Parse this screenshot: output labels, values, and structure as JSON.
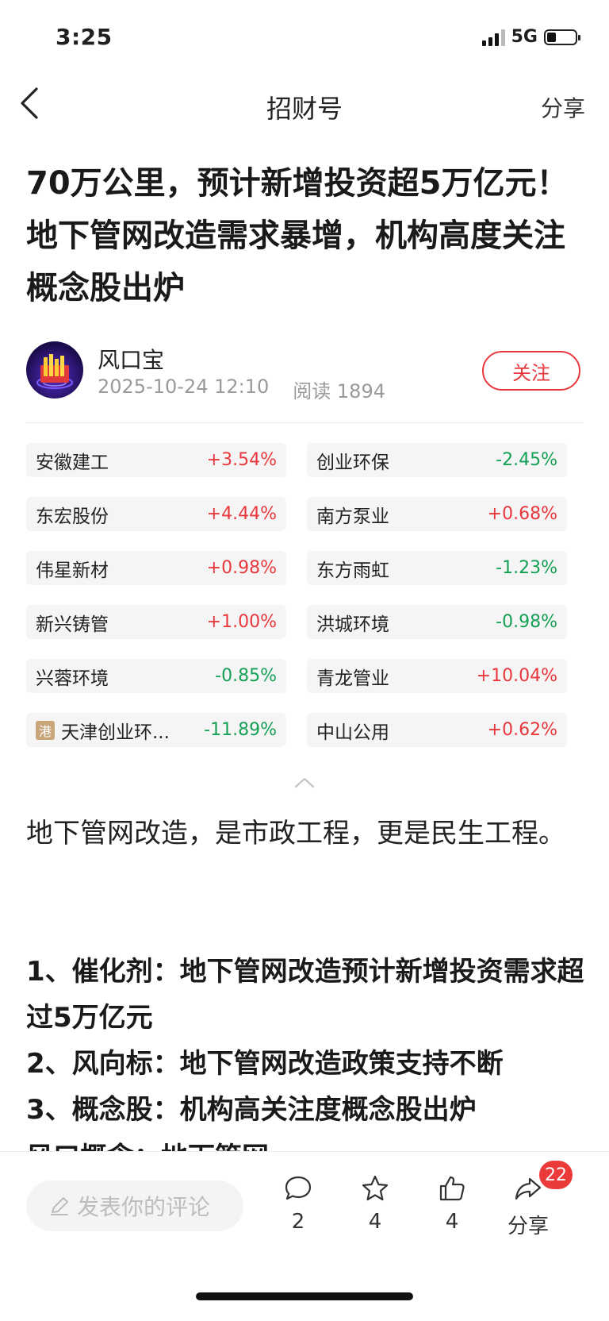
{
  "status_bar": {
    "time": "3:25",
    "network": "5G"
  },
  "nav": {
    "title": "招财号",
    "share_label": "分享"
  },
  "article": {
    "title": "70万公里，预计新增投资超5万亿元！地下管网改造需求暴增，机构高度关注概念股出炉",
    "author": "风口宝",
    "date": "2025-10-24 12:10",
    "read_label": "阅读 1894",
    "follow_label": "关注"
  },
  "stocks": [
    {
      "name": "安徽建工",
      "change": "+3.54%",
      "dir": "up"
    },
    {
      "name": "创业环保",
      "change": "-2.45%",
      "dir": "down"
    },
    {
      "name": "东宏股份",
      "change": "+4.44%",
      "dir": "up"
    },
    {
      "name": "南方泵业",
      "change": "+0.68%",
      "dir": "up"
    },
    {
      "name": "伟星新材",
      "change": "+0.98%",
      "dir": "up"
    },
    {
      "name": "东方雨虹",
      "change": "-1.23%",
      "dir": "down"
    },
    {
      "name": "新兴铸管",
      "change": "+1.00%",
      "dir": "up"
    },
    {
      "name": "洪城环境",
      "change": "-0.98%",
      "dir": "down"
    },
    {
      "name": "兴蓉环境",
      "change": "-0.85%",
      "dir": "down"
    },
    {
      "name": "青龙管业",
      "change": "+10.04%",
      "dir": "up"
    },
    {
      "name": "天津创业环...",
      "change": "-11.89%",
      "dir": "down",
      "badge": "港"
    },
    {
      "name": "中山公用",
      "change": "+0.62%",
      "dir": "up"
    }
  ],
  "body": {
    "intro": "地下管网改造，是市政工程，更是民生工程。",
    "points": [
      "1、催化剂：地下管网改造预计新增投资需求超过5万亿元",
      "2、风向标：地下管网改造政策支持不断",
      "3、概念股：机构高关注度概念股出炉"
    ],
    "cut_off_line": "风口概念：地下管网"
  },
  "bottom_bar": {
    "comment_placeholder": "发表你的评论",
    "comments": "2",
    "favorites": "4",
    "likes": "4",
    "share_label": "分享",
    "share_badge": "22"
  },
  "colors": {
    "up": "#e8383d",
    "down": "#14a055",
    "accent": "#e8383d"
  }
}
